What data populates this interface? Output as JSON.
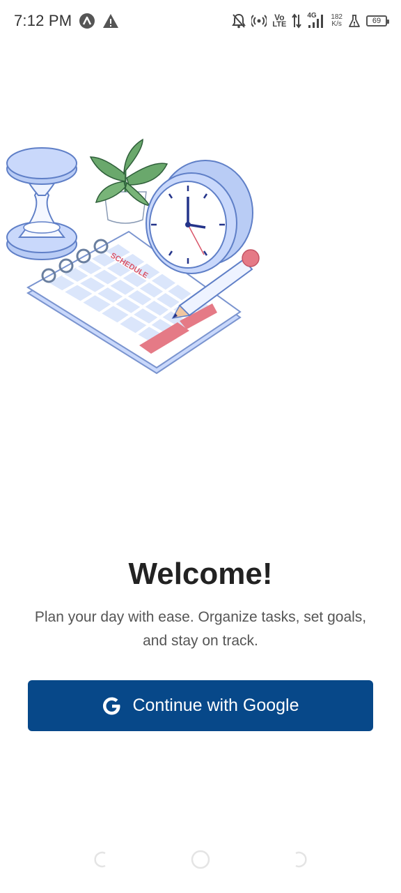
{
  "status_bar": {
    "time": "7:12 PM",
    "icons": [
      "app-a-icon",
      "warning-icon",
      "silent-icon",
      "hotspot-icon",
      "volte-icon",
      "data-arrows-icon",
      "4g-signal-icon",
      "speed-icon",
      "flask-icon",
      "battery-icon"
    ],
    "volte_top": "Vo",
    "volte_bottom": "LTE",
    "network_type": "4G",
    "speed_value": "182",
    "speed_unit": "K/s",
    "battery_level": "69"
  },
  "illustration": {
    "schedule_label": "SCHEDULE"
  },
  "welcome": {
    "title": "Welcome!",
    "subtitle": "Plan your day with ease. Organize tasks, set goals, and stay on track."
  },
  "google_button": {
    "label": "Continue with Google",
    "icon": "google-g-icon",
    "background_color": "#074889"
  },
  "nav_bar": {
    "buttons": [
      "back-icon",
      "home-icon",
      "recents-icon"
    ]
  }
}
